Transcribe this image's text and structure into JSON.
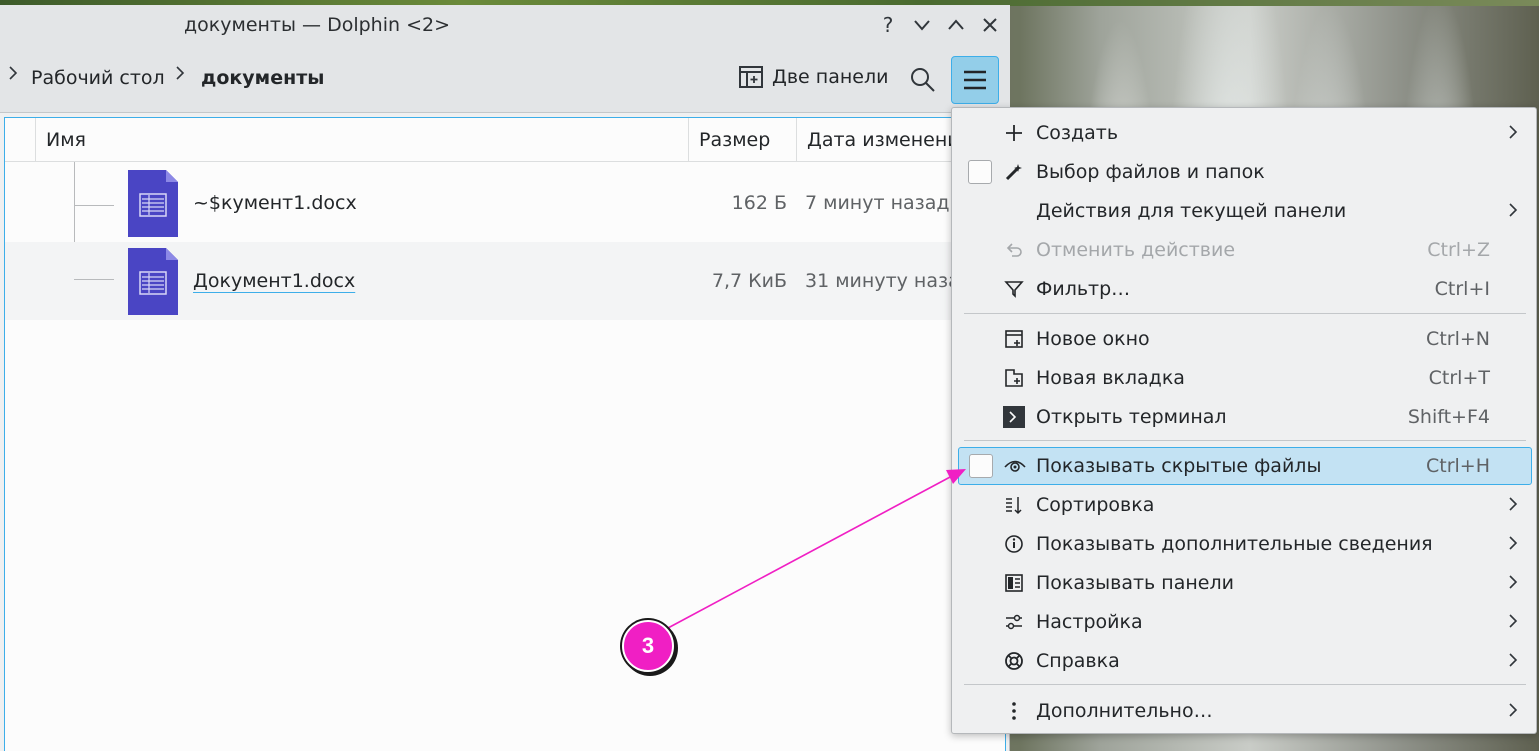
{
  "window": {
    "title": "документы — Dolphin <2>",
    "help_glyph": "?",
    "min_glyph": "∨",
    "max_glyph": "∧",
    "close_glyph": "✕"
  },
  "toolbar": {
    "breadcrumb": [
      "Рабочий стол",
      "документы"
    ],
    "split_label": "Две панели"
  },
  "columns": [
    "Имя",
    "Размер",
    "Дата изменени"
  ],
  "files": [
    {
      "name": "~$кумент1.docx",
      "size": "162 Б",
      "modified": "7 минут назад"
    },
    {
      "name": "Документ1.docx",
      "size": "7,7 КиБ",
      "modified": "31 минуту назад"
    }
  ],
  "menu": {
    "items": [
      {
        "label": "Создать",
        "icon": "plus-icon",
        "submenu": true
      },
      {
        "label": "Выбор файлов и папок",
        "icon": "wand-icon",
        "checkbox": true
      },
      {
        "label": "Действия для текущей панели",
        "submenu": true
      },
      {
        "label": "Отменить действие",
        "icon": "undo-icon",
        "shortcut": "Ctrl+Z",
        "disabled": true
      },
      {
        "label": "Фильтр…",
        "icon": "filter-icon",
        "shortcut": "Ctrl+I"
      },
      {
        "label": "Новое окно",
        "icon": "new-window-icon",
        "shortcut": "Ctrl+N"
      },
      {
        "label": "Новая вкладка",
        "icon": "new-tab-icon",
        "shortcut": "Ctrl+T"
      },
      {
        "label": "Открыть терминал",
        "icon": "terminal-icon",
        "shortcut": "Shift+F4"
      },
      {
        "label": "Показывать скрытые файлы",
        "icon": "eye-icon",
        "shortcut": "Ctrl+H",
        "checkbox": true,
        "highlighted": true
      },
      {
        "label": "Сортировка",
        "icon": "sort-icon",
        "submenu": true
      },
      {
        "label": "Показывать дополнительные сведения",
        "icon": "info-icon",
        "submenu": true
      },
      {
        "label": "Показывать панели",
        "icon": "panels-icon",
        "submenu": true
      },
      {
        "label": "Настройка",
        "icon": "settings-icon",
        "submenu": true
      },
      {
        "label": "Справка",
        "icon": "help-icon",
        "submenu": true
      },
      {
        "label": "Дополнительно…",
        "icon": "more-icon",
        "submenu": true
      }
    ]
  },
  "annotation": {
    "number": "3",
    "color": "#f01fc4"
  }
}
